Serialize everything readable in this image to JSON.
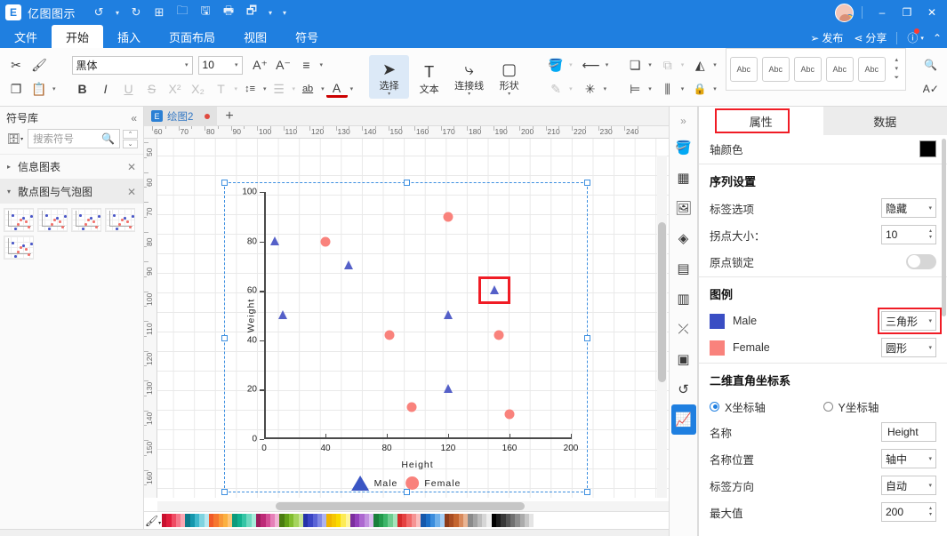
{
  "titlebar": {
    "logo": "E",
    "app_name": "亿图图示",
    "quick_access": [
      {
        "name": "undo-button",
        "glyph": "↺"
      },
      {
        "name": "undo-caret",
        "glyph": "▾"
      },
      {
        "name": "redo-button",
        "glyph": "↻"
      },
      {
        "name": "new-button",
        "glyph": "⊞"
      },
      {
        "name": "open-button",
        "glyph": "🗀"
      },
      {
        "name": "save-button",
        "glyph": "🖫"
      },
      {
        "name": "print-button",
        "glyph": "🖶"
      },
      {
        "name": "export-button",
        "glyph": "🗗"
      },
      {
        "name": "export-caret",
        "glyph": "▾"
      },
      {
        "name": "more-caret",
        "glyph": "▾"
      }
    ],
    "publish_label": "发布",
    "share_label": "分享",
    "publish_icon": "➢",
    "share_icon": "⋖",
    "help_icon": "?",
    "help_caret": "▾",
    "collapse_caret": "⌃",
    "minimize": "–",
    "maximize": "❐",
    "close": "✕"
  },
  "ribbon_tabs": [
    {
      "label": "文件",
      "active": false
    },
    {
      "label": "开始",
      "active": true
    },
    {
      "label": "插入",
      "active": false
    },
    {
      "label": "页面布局",
      "active": false
    },
    {
      "label": "视图",
      "active": false
    },
    {
      "label": "符号",
      "active": false
    }
  ],
  "ribbon": {
    "clipboard": {
      "cut_icon": "✂",
      "format_painter_icon": "🖌",
      "copy_icon": "❐",
      "paste_icon": "📋",
      "paste_caret": "▾"
    },
    "font": {
      "family_value": "黑体",
      "size_value": "10",
      "grow_icon": "A⁺",
      "shrink_icon": "A⁻",
      "align_icon": "≡",
      "bold": "B",
      "italic": "I",
      "underline": "U",
      "strike": "S",
      "superscript": "X²",
      "subscript": "X₂",
      "clear_format": "T",
      "line_spacing": "↕≡",
      "bullets": "☰",
      "highlight": "ab",
      "font_color": "A"
    },
    "tools": [
      {
        "label": "选择",
        "icon": "➤",
        "active": true,
        "has_caret": true
      },
      {
        "label": "文本",
        "icon": "T",
        "active": false,
        "has_caret": false
      },
      {
        "label": "连接线",
        "icon": "⤷",
        "active": false,
        "has_caret": true
      },
      {
        "label": "形状",
        "icon": "▢",
        "active": false,
        "has_caret": true
      }
    ],
    "style_tools": {
      "fill_icon": "🪣",
      "line_arrow_icon": "⟵",
      "pen_icon": "✎",
      "effects_icon": "✳"
    },
    "arrange_tools": {
      "bring_front_icon": "❏",
      "group_icon": "⧉",
      "flip_icon": "◭",
      "align_icon": "⊨",
      "distribute_icon": "⫼",
      "lock_icon": "🔒"
    },
    "gallery_chips": [
      "Abc",
      "Abc",
      "Abc",
      "Abc",
      "Abc"
    ],
    "gallery_scroll": [
      "▴",
      "▾",
      "⏷"
    ],
    "right_tools": {
      "find_icon": "🔍",
      "crop_icon": "⛶",
      "spell_icon": "A✓",
      "shape_ops_icon": "❏"
    }
  },
  "sidebar": {
    "title": "符号库",
    "collapse_icon": "«",
    "search_placeholder": "搜索符号",
    "search_icon": "🔍",
    "category_icon": "🗄",
    "category_caret": "▾",
    "spin_up": "⌃",
    "spin_down": "⌄",
    "groups": [
      {
        "label": "信息图表",
        "open": false,
        "arrow": "▸",
        "close": "✕"
      },
      {
        "label": "散点图与气泡图",
        "open": true,
        "arrow": "▾",
        "close": "✕"
      }
    ],
    "thumb_count": 5
  },
  "canvas": {
    "tab_label": "绘图2",
    "tab_icon": "E",
    "tab_modified": true,
    "add_tab": "+",
    "h_ruler_start": 55,
    "h_ruler_labels": [
      60,
      70,
      80,
      90,
      100,
      110,
      120,
      130,
      140,
      150,
      160,
      170,
      180,
      190,
      200,
      210,
      220,
      230,
      240
    ],
    "v_ruler_labels": [
      50,
      60,
      70,
      80,
      90,
      100,
      110,
      120,
      130,
      140,
      150,
      160
    ]
  },
  "chart_data": {
    "type": "scatter",
    "title": "",
    "xlabel": "Height",
    "ylabel": "Weight",
    "xlim": [
      0,
      200
    ],
    "ylim": [
      0,
      100
    ],
    "xticks": [
      0,
      40,
      80,
      120,
      160,
      200
    ],
    "yticks": [
      0,
      20,
      40,
      60,
      80,
      100
    ],
    "grid": true,
    "legend_position": "bottom",
    "series": [
      {
        "name": "Male",
        "marker": "triangle",
        "color": "#5560c8",
        "points": [
          {
            "x": 7,
            "y": 80
          },
          {
            "x": 12,
            "y": 50
          },
          {
            "x": 55,
            "y": 70
          },
          {
            "x": 120,
            "y": 50
          },
          {
            "x": 120,
            "y": 20
          },
          {
            "x": 150,
            "y": 60,
            "selected": true
          }
        ]
      },
      {
        "name": "Female",
        "marker": "circle",
        "color": "#f9827c",
        "points": [
          {
            "x": 40,
            "y": 80
          },
          {
            "x": 82,
            "y": 42
          },
          {
            "x": 96,
            "y": 13
          },
          {
            "x": 120,
            "y": 90
          },
          {
            "x": 153,
            "y": 42
          },
          {
            "x": 160,
            "y": 10
          }
        ]
      }
    ]
  },
  "annotations": {
    "marker_highlight_color": "#f01c25",
    "arrow_color": "#ee1c25",
    "tab_highlight_color": "#f01c25",
    "dropdown_highlight_color": "#f01c25"
  },
  "rail_icons": [
    {
      "name": "expand-chevron-icon",
      "glyph": "»",
      "active": false
    },
    {
      "name": "fill-icon",
      "glyph": "🪣",
      "active": false
    },
    {
      "name": "grid-apps-icon",
      "glyph": "▦",
      "active": false
    },
    {
      "name": "image-icon",
      "glyph": "🖼",
      "active": false
    },
    {
      "name": "layers-icon",
      "glyph": "◈",
      "active": false
    },
    {
      "name": "document-icon",
      "glyph": "▤",
      "active": false
    },
    {
      "name": "shapes-panel-icon",
      "glyph": "▥",
      "active": false
    },
    {
      "name": "connector-icon",
      "glyph": "⤫",
      "active": false
    },
    {
      "name": "presentation-icon",
      "glyph": "▣",
      "active": false
    },
    {
      "name": "history-icon",
      "glyph": "↺",
      "active": false
    },
    {
      "name": "chart-icon",
      "glyph": "📈",
      "active": true
    }
  ],
  "properties_panel": {
    "tabs": [
      {
        "label": "属性",
        "active": true,
        "highlighted": true
      },
      {
        "label": "数据",
        "active": false,
        "highlighted": false
      }
    ],
    "axis_color_label": "轴颜色",
    "axis_color_value": "#000000",
    "series_section": "序列设置",
    "label_option_label": "标签选项",
    "label_option_value": "隐藏",
    "point_size_label": "拐点大小：",
    "point_size_value": "10",
    "origin_lock_label": "原点锁定",
    "origin_lock_on": false,
    "legend_section": "图例",
    "legend_items": [
      {
        "name": "Male",
        "color": "#3a4ec4",
        "shape_value": "三角形",
        "highlighted": true
      },
      {
        "name": "Female",
        "color": "#f9827c",
        "shape_value": "圆形",
        "highlighted": false
      }
    ],
    "coord_section": "二维直角坐标系",
    "axis_radio": [
      {
        "label": "X坐标轴",
        "selected": true
      },
      {
        "label": "Y坐标轴",
        "selected": false
      }
    ],
    "name_label": "名称",
    "name_value": "Height",
    "name_pos_label": "名称位置",
    "name_pos_value": "轴中",
    "label_dir_label": "标签方向",
    "label_dir_value": "自动",
    "max_label": "最大值",
    "max_value": "200",
    "caret": "▾"
  },
  "palette": {
    "eyedropper_icon": "🖉",
    "colors": [
      "#c8102e",
      "#e01d3c",
      "#ef4b63",
      "#f5798c",
      "#f9a7b3",
      "#0e7a8b",
      "#1597ad",
      "#3fb8cc",
      "#7ed3e0",
      "#b8e8f0",
      "#f05a28",
      "#f6772f",
      "#f89838",
      "#fbb040",
      "#fdc67a",
      "#0d9b7c",
      "#12b08e",
      "#34c5a5",
      "#6fd9c0",
      "#a8ecdb",
      "#9c1f5e",
      "#bd2a77",
      "#d44f96",
      "#e680b8",
      "#f2b3d6",
      "#4a7c10",
      "#63a018",
      "#81bd2f",
      "#a5d45d",
      "#c7e594",
      "#2533a8",
      "#3a45c4",
      "#5a63d6",
      "#8189e4",
      "#aeb3ef",
      "#f0b400",
      "#f6c700",
      "#fada00",
      "#fdeb55",
      "#fef59c",
      "#7b2d9e",
      "#9440bc",
      "#ad68d0",
      "#c392e0",
      "#dbbcef",
      "#1a7f3c",
      "#229a4c",
      "#3bb568",
      "#6fcd90",
      "#a5e3bb",
      "#d42a2a",
      "#e54141",
      "#ef6a6a",
      "#f59494",
      "#fabebe",
      "#1558ab",
      "#1d6fc7",
      "#3b8ddd",
      "#6fb0ea",
      "#a6cef4",
      "#8c3b1a",
      "#a94d22",
      "#c4652f",
      "#d98a5c",
      "#e9b493",
      "#8a8a8a",
      "#a3a3a3",
      "#bdbdbd",
      "#d6d6d6",
      "#eeeeee",
      "#000000",
      "#1c1c1c",
      "#383838",
      "#555555",
      "#717171",
      "#8e8e8e",
      "#ababab",
      "#c8c8c8",
      "#e4e4e4",
      "#ffffff"
    ]
  }
}
